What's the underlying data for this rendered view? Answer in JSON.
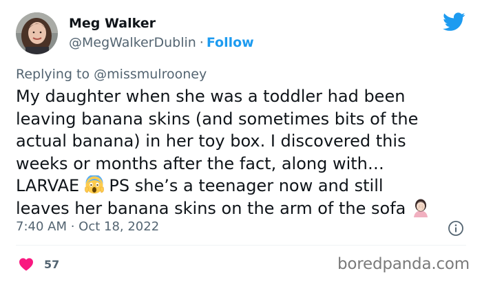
{
  "author": {
    "name": "Meg Walker",
    "handle": "@MegWalkerDublin",
    "separator": "·",
    "follow_label": "Follow"
  },
  "reply_context": {
    "prefix": "Replying to",
    "mention": "@missmulrooney"
  },
  "tweet": {
    "lines": [
      "My daughter when she was a toddler had been",
      "leaving banana skins (and sometimes bits of the",
      "actual banana) in her toy box. I discovered this",
      "weeks or months after the fact, along with…",
      {
        "before": "LARVAE ",
        "emoji": "scream-emoji",
        "after": " PS she’s a teenager now and still"
      },
      {
        "before": "leaves her banana skins on the arm of the sofa ",
        "emoji": "facepalm-emoji"
      }
    ]
  },
  "timestamp": "7:40 AM · Oct 18, 2022",
  "engagement": {
    "likes": "57",
    "like_icon": "heart-icon"
  },
  "icons": {
    "platform": "twitter-bird-icon",
    "info": "info-icon"
  },
  "watermark": "boredpanda.com",
  "colors": {
    "accent": "#1d9bf0",
    "text": "#0f1419",
    "secondary_text": "#536471",
    "like": "#f91880",
    "divider": "#eff3f4"
  }
}
